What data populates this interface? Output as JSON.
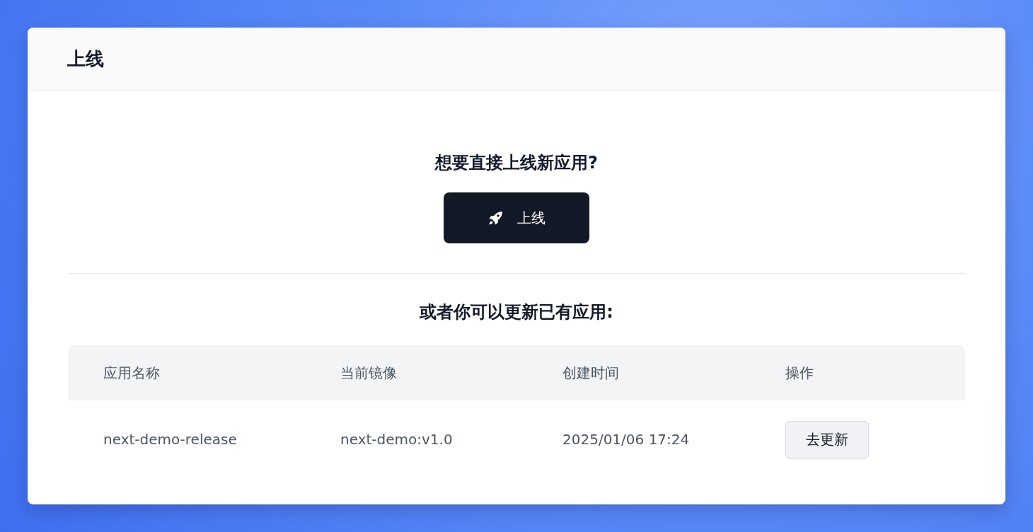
{
  "panel": {
    "title": "上线"
  },
  "new_app": {
    "heading": "想要直接上线新应用?",
    "button": "上线"
  },
  "existing": {
    "heading": "或者你可以更新已有应用:"
  },
  "table": {
    "columns": [
      "应用名称",
      "当前镜像",
      "创建时间",
      "操作"
    ],
    "rows": [
      {
        "name": "next-demo-release",
        "image": "next-demo:v1.0",
        "created": "2025/01/06 17:24",
        "action": "去更新"
      }
    ]
  }
}
